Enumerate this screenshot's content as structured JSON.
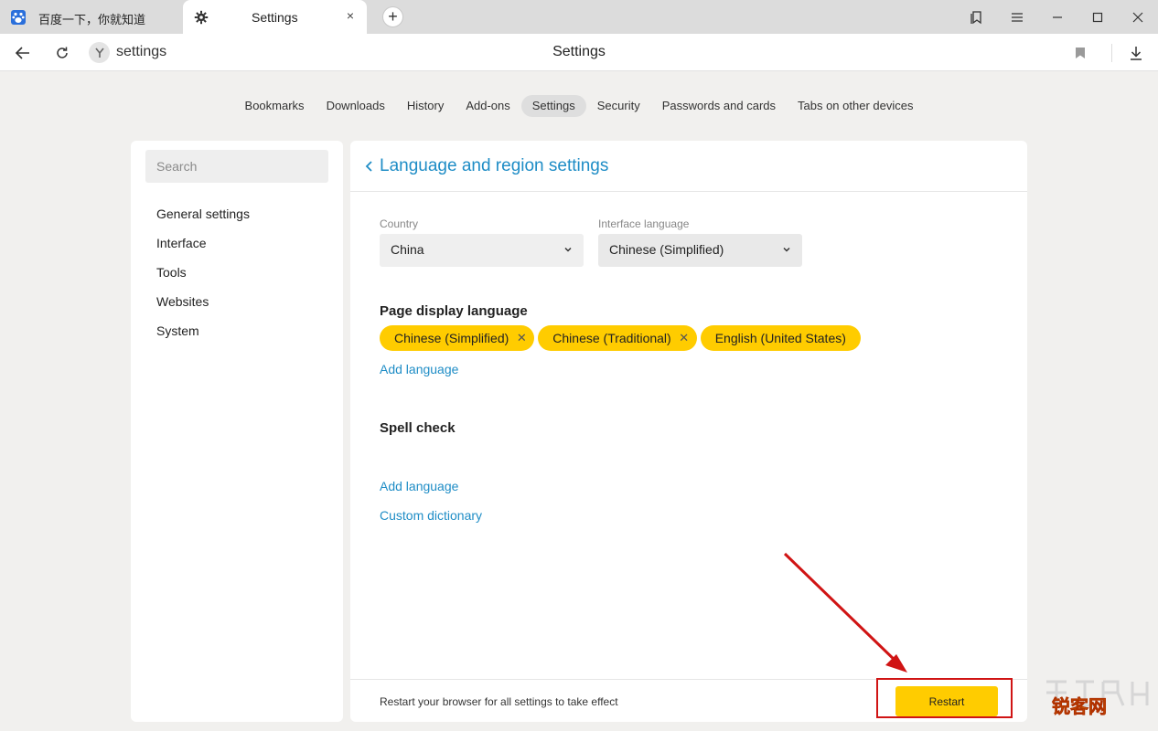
{
  "tabs": [
    {
      "title": "百度一下，你就知道",
      "favicon": "baidu-paw-icon",
      "active": false
    },
    {
      "title": "Settings",
      "favicon": "gear-icon",
      "active": true,
      "close": "×"
    }
  ],
  "new_tab_label": "+",
  "address_bar": {
    "url_text": "settings",
    "page_title": "Settings"
  },
  "settings_nav": [
    {
      "label": "Bookmarks"
    },
    {
      "label": "Downloads"
    },
    {
      "label": "History"
    },
    {
      "label": "Add-ons"
    },
    {
      "label": "Settings",
      "selected": true
    },
    {
      "label": "Security"
    },
    {
      "label": "Passwords and cards"
    },
    {
      "label": "Tabs on other devices"
    }
  ],
  "sidebar": {
    "search_placeholder": "Search",
    "items": [
      {
        "label": "General settings"
      },
      {
        "label": "Interface"
      },
      {
        "label": "Tools"
      },
      {
        "label": "Websites"
      },
      {
        "label": "System"
      }
    ]
  },
  "main": {
    "title": "Language and region settings",
    "country": {
      "label": "Country",
      "value": "China"
    },
    "interface_language": {
      "label": "Interface language",
      "value": "Chinese (Simplified)"
    },
    "page_display_language": {
      "title": "Page display language",
      "chips": [
        {
          "label": "Chinese (Simplified)",
          "removable": true
        },
        {
          "label": "Chinese (Traditional)",
          "removable": true
        },
        {
          "label": "English (United States)",
          "removable": false
        }
      ],
      "add_link": "Add language"
    },
    "spell_check": {
      "title": "Spell check",
      "add_link": "Add language",
      "dictionary_link": "Custom dictionary"
    },
    "footer": {
      "message": "Restart your browser for all settings to take effect",
      "restart_label": "Restart"
    }
  },
  "colors": {
    "accent": "#1f8dc6",
    "chip": "#ffcc00",
    "highlight": "#d01414"
  },
  "watermark": {
    "text": "锐客网"
  }
}
